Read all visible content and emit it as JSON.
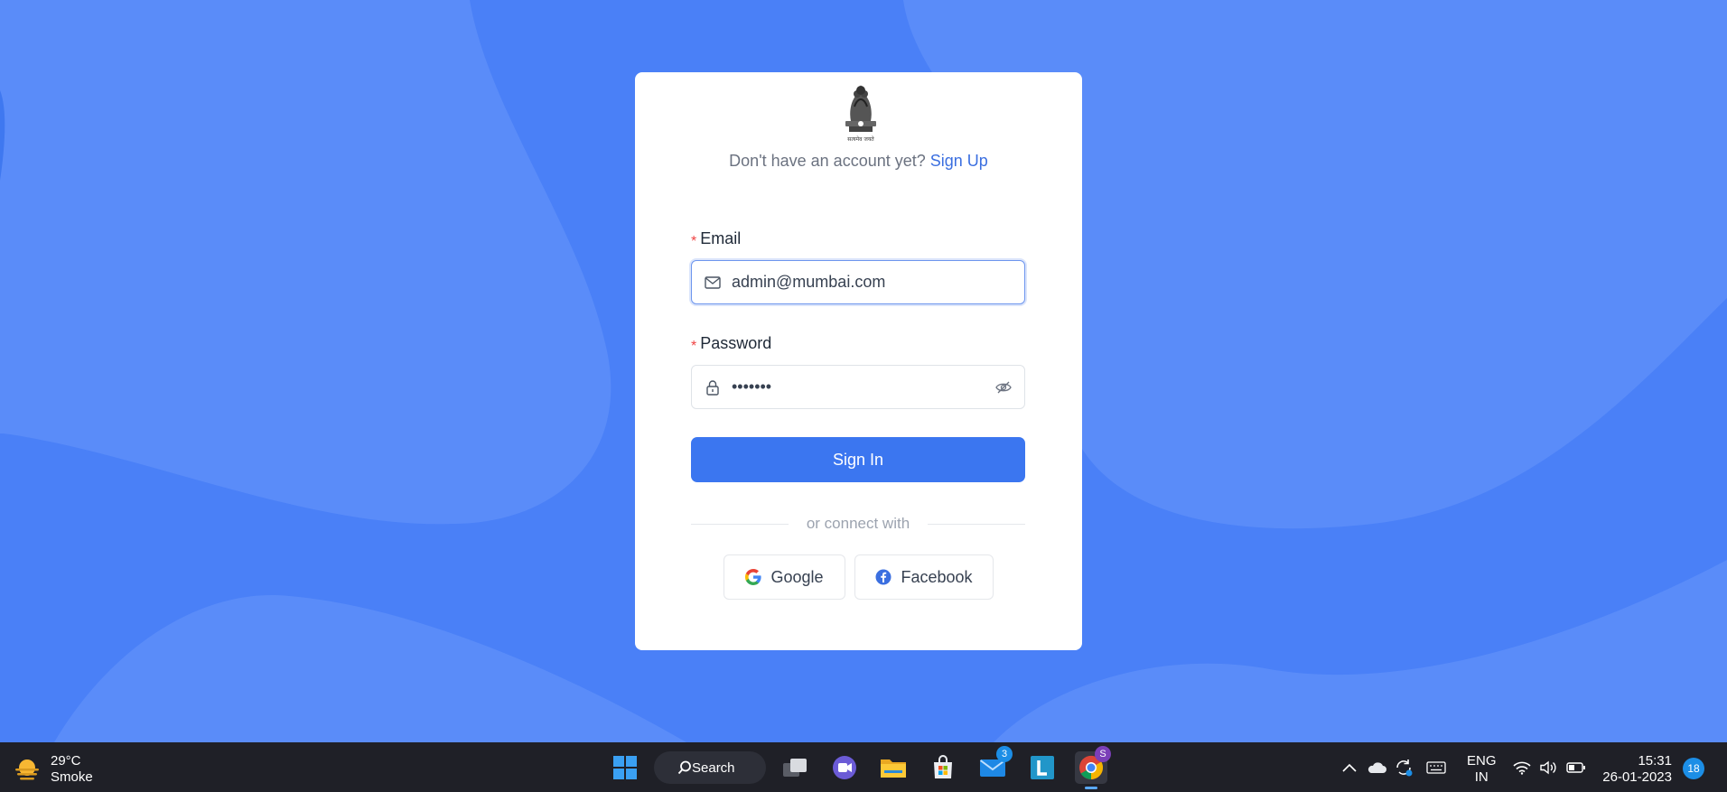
{
  "login": {
    "signup_prompt": "Don't have an account yet?",
    "signup_link": "Sign Up",
    "email_label": "Email",
    "email_value": "admin@mumbai.com",
    "password_label": "Password",
    "password_value": "•••••••",
    "signin_label": "Sign In",
    "divider_text": "or connect with",
    "google_label": "Google",
    "facebook_label": "Facebook",
    "emblem_text": "सत्यमेव जयते"
  },
  "taskbar": {
    "weather_temp": "29°C",
    "weather_desc": "Smoke",
    "search_label": "Search",
    "mail_badge": "3",
    "chrome_badge": "S",
    "lang_top": "ENG",
    "lang_bottom": "IN",
    "time": "15:31",
    "date": "26-01-2023",
    "notifications": "18"
  },
  "colors": {
    "background": "#4a80f7",
    "primary_button": "#3b76f0",
    "link": "#3b6fe0",
    "required": "#ef4444"
  }
}
